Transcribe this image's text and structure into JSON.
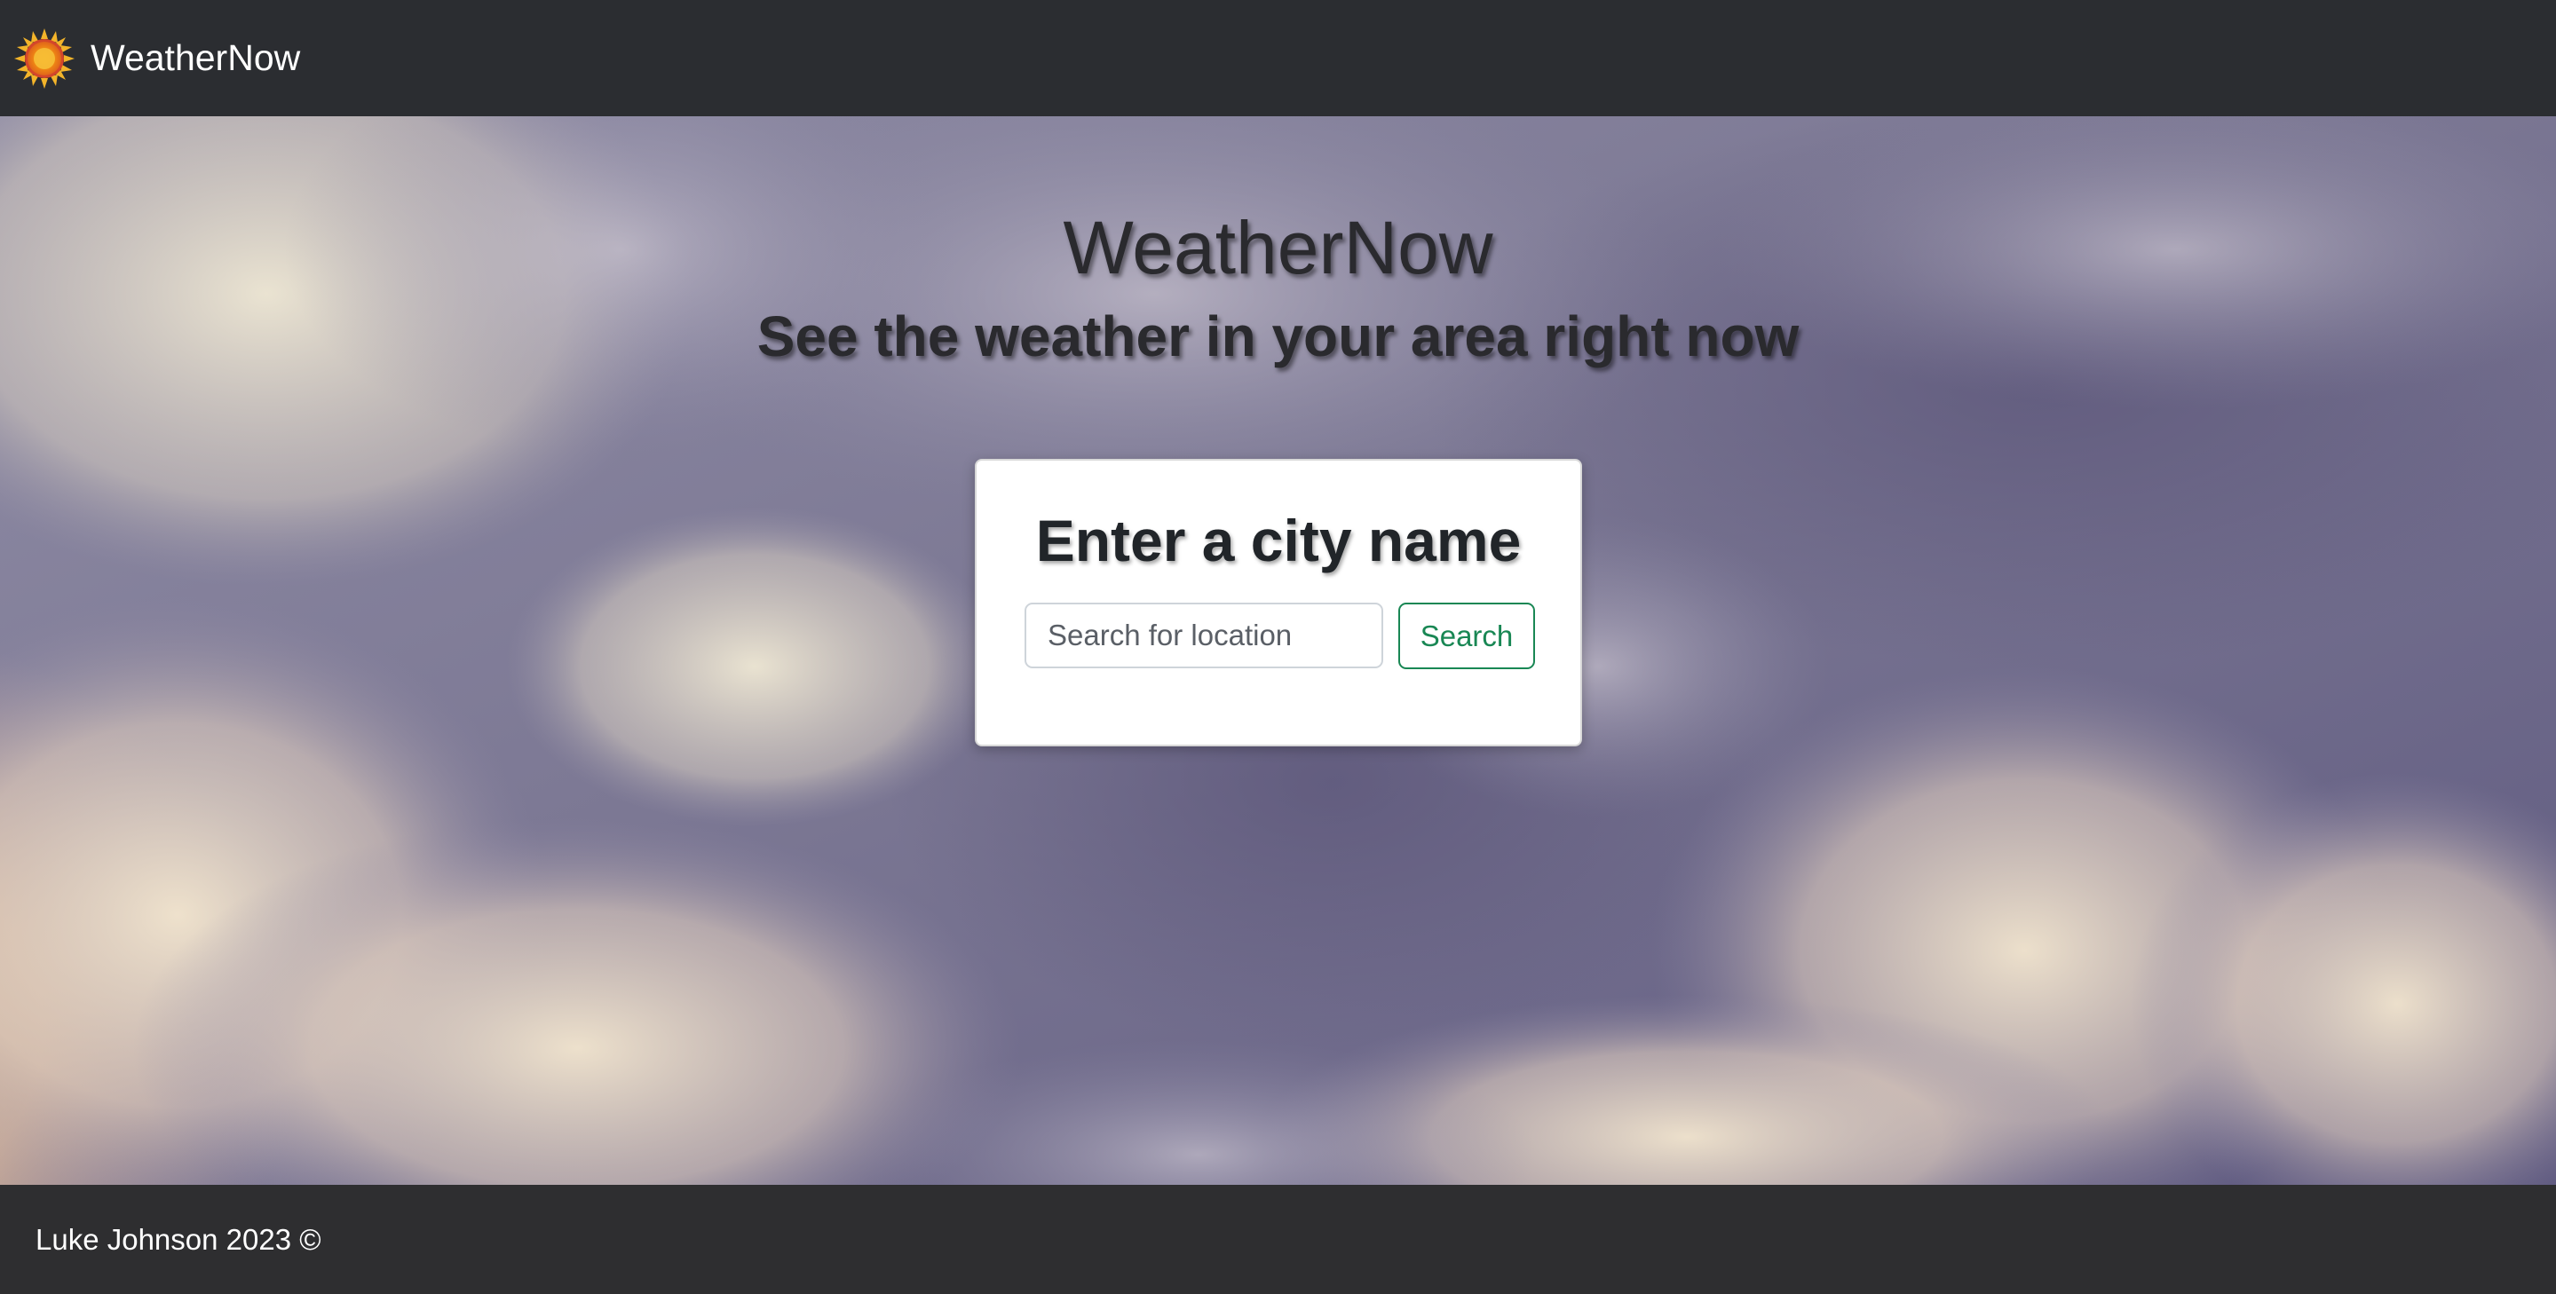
{
  "navbar": {
    "brand": "WeatherNow",
    "logo_icon": "sun-icon"
  },
  "hero": {
    "title": "WeatherNow",
    "subtitle": "See the weather in your area right now",
    "background": "cloudy-sky-image"
  },
  "search_card": {
    "title": "Enter a city name",
    "input_placeholder": "Search for location",
    "input_value": "",
    "button_label": "Search"
  },
  "footer": {
    "text": "Luke Johnson 2023 ©"
  },
  "colors": {
    "navbar_bg": "#2b2d31",
    "footer_bg": "#2e2e30",
    "button_accent": "#198754",
    "heading_text": "#2a2a2e"
  }
}
